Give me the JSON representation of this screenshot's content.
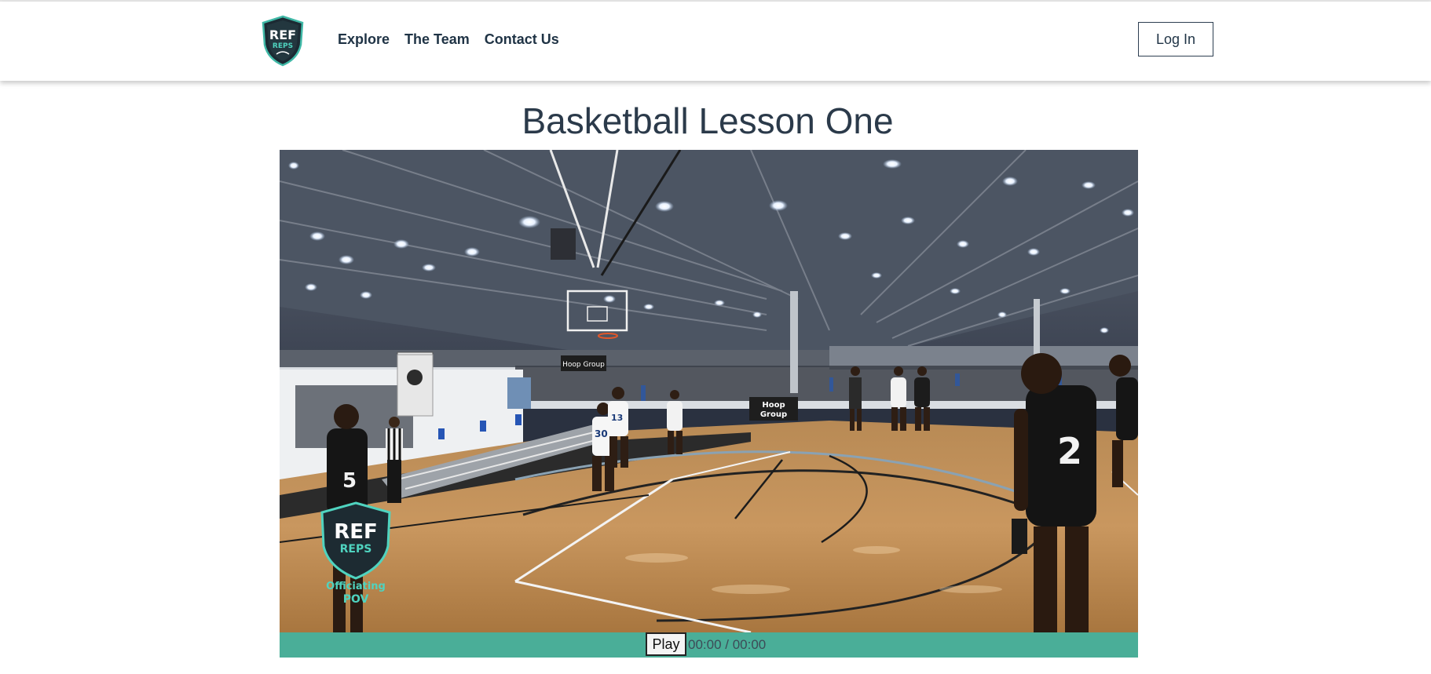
{
  "header": {
    "logo_text_top": "REF",
    "logo_text_bottom": "REPS",
    "nav": [
      {
        "label": "Explore"
      },
      {
        "label": "The Team"
      },
      {
        "label": "Contact Us"
      }
    ],
    "login_label": "Log In"
  },
  "main": {
    "title": "Basketball Lesson One"
  },
  "video": {
    "watermark_top": "REF",
    "watermark_mid": "REPS",
    "watermark_caption_1": "Officiating",
    "watermark_caption_2": "POV",
    "banner_text": "Hoop Group",
    "banner_text_2": "Hoop",
    "banner_text_3": "Group",
    "player_numbers": [
      "5",
      "30",
      "13",
      "2"
    ]
  },
  "controls": {
    "play_label": "Play",
    "time": "00:00 / 00:00",
    "bar_color": "#4aae98"
  }
}
